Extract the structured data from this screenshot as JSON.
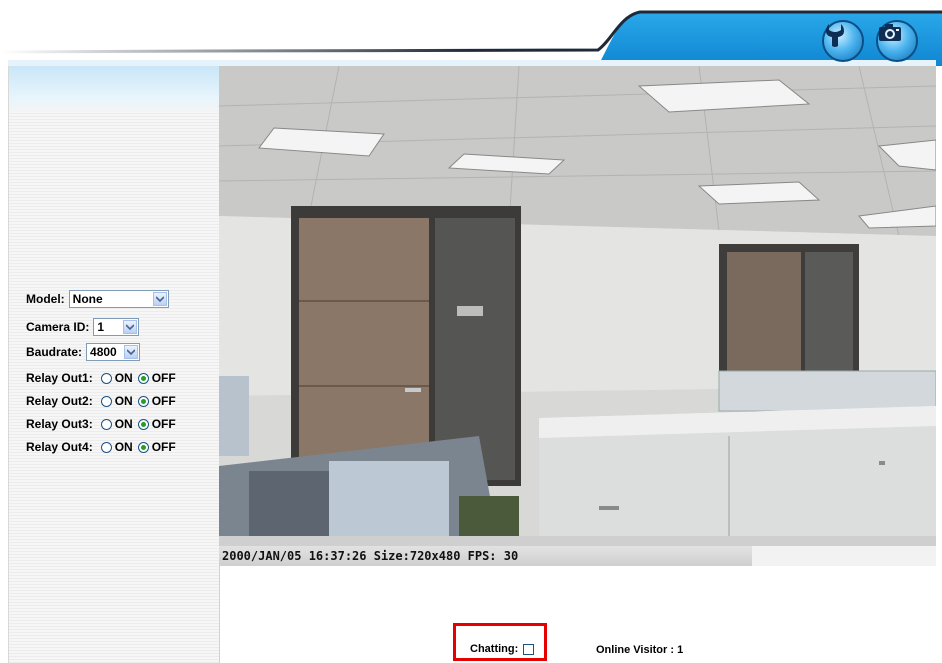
{
  "toolbar": {
    "setup_icon": "wrench-icon",
    "snapshot_icon": "camera-icon",
    "accent_color": "#1b9be0"
  },
  "controls": {
    "model_label": "Model:",
    "model_value": "None",
    "camera_id_label": "Camera ID:",
    "camera_id_value": "1",
    "baudrate_label": "Baudrate:",
    "baudrate_value": "4800",
    "relays": [
      {
        "label": "Relay Out1:",
        "on": "ON",
        "off": "OFF",
        "selected": "OFF"
      },
      {
        "label": "Relay Out2:",
        "on": "ON",
        "off": "OFF",
        "selected": "OFF"
      },
      {
        "label": "Relay Out3:",
        "on": "ON",
        "off": "OFF",
        "selected": "OFF"
      },
      {
        "label": "Relay Out4:",
        "on": "ON",
        "off": "OFF",
        "selected": "OFF"
      }
    ]
  },
  "video": {
    "osd_text": "2000/JAN/05 16:37:26 Size:720x480 FPS: 30"
  },
  "footer": {
    "chatting_label": "Chatting:",
    "online_visitor": "Online Visitor : 1"
  }
}
